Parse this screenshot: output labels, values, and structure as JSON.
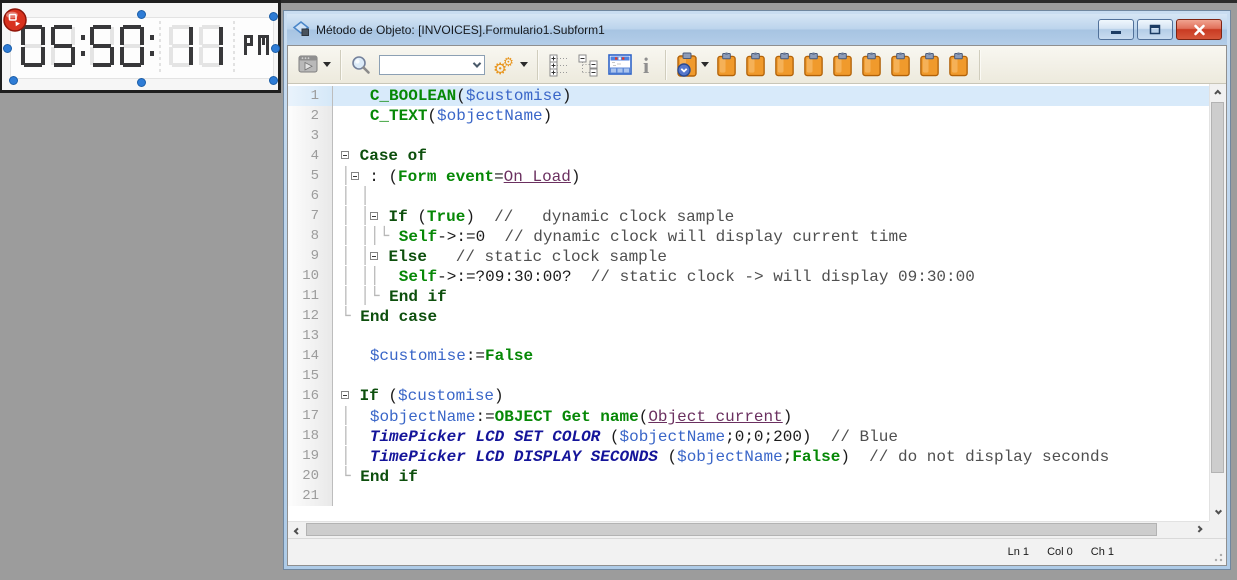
{
  "form_editor": {
    "clock_widget": {
      "time": "05:50:11",
      "meridiem": "PM",
      "ghost_pattern": "88:88:88",
      "lcd_on_color": "#38383a",
      "lcd_ghost_color": "#e4e4e4",
      "selection_color": "#2e7cd6",
      "badge_color": "#d8321e"
    }
  },
  "window": {
    "title": "Método de Objeto: [INVOICES].Formulario1.Subform1",
    "titlebar_icon": "method-icon",
    "controls": [
      "minimize",
      "maximize",
      "close"
    ]
  },
  "toolbar": {
    "icons": [
      "execute-method-icon",
      "find-icon",
      "search-combobox",
      "macros-gears-icon",
      "expand-all-icon",
      "collapse-all-icon",
      "form-preview-icon",
      "info-icon",
      "clipboard-clock-icon",
      "clipboard-icon"
    ],
    "search_value": "",
    "clipboard_count": 9,
    "clipboard_color": "#f09a2c"
  },
  "editor": {
    "active_line": 1,
    "palette": {
      "cmd": "#068806",
      "kw": "#0d4f0d",
      "var": "#3a66c8",
      "const": "#6b3060",
      "plug": "#14149a",
      "cmt": "#4f4f4f",
      "pl": "#1a1a1a"
    },
    "lines": [
      {
        "n": 1,
        "hl": true,
        "s": [
          [
            "pl",
            "   "
          ],
          [
            "cmd",
            "C_BOOLEAN"
          ],
          [
            "pl",
            "("
          ],
          [
            "var",
            "$customise"
          ],
          [
            "pl",
            ")"
          ]
        ]
      },
      {
        "n": 2,
        "s": [
          [
            "pl",
            "   "
          ],
          [
            "cmd",
            "C_TEXT"
          ],
          [
            "pl",
            "("
          ],
          [
            "var",
            "$objectName"
          ],
          [
            "pl",
            ")"
          ]
        ]
      },
      {
        "n": 3,
        "s": []
      },
      {
        "n": 4,
        "s": [
          [
            "fold",
            ""
          ],
          [
            "pl",
            " "
          ],
          [
            "kw",
            "Case of"
          ]
        ]
      },
      {
        "n": 5,
        "s": [
          [
            "tr",
            "│"
          ],
          [
            "fold",
            ""
          ],
          [
            "pl",
            " : ("
          ],
          [
            "cmd",
            "Form event"
          ],
          [
            "pl",
            "="
          ],
          [
            "const",
            "On Load"
          ],
          [
            "pl",
            ")"
          ]
        ]
      },
      {
        "n": 6,
        "s": [
          [
            "tr",
            "│ │"
          ]
        ]
      },
      {
        "n": 7,
        "s": [
          [
            "tr",
            "│ │"
          ],
          [
            "fold",
            ""
          ],
          [
            "pl",
            " "
          ],
          [
            "kw",
            "If"
          ],
          [
            "pl",
            " ("
          ],
          [
            "cmd",
            "True"
          ],
          [
            "pl",
            ")  "
          ],
          [
            "cmt",
            "//   dynamic clock sample"
          ]
        ]
      },
      {
        "n": 8,
        "s": [
          [
            "tr",
            "│ ││└"
          ],
          [
            "pl",
            " "
          ],
          [
            "cmd",
            "Self"
          ],
          [
            "pl",
            "->:=0  "
          ],
          [
            "cmt",
            "// dynamic clock will display current time"
          ]
        ]
      },
      {
        "n": 9,
        "s": [
          [
            "tr",
            "│ │"
          ],
          [
            "fold",
            ""
          ],
          [
            "pl",
            " "
          ],
          [
            "kw",
            "Else"
          ],
          [
            "pl",
            "   "
          ],
          [
            "cmt",
            "// static clock sample"
          ]
        ]
      },
      {
        "n": 10,
        "s": [
          [
            "tr",
            "│ ││"
          ],
          [
            "pl",
            "  "
          ],
          [
            "cmd",
            "Self"
          ],
          [
            "pl",
            "->:=?09:30:00?  "
          ],
          [
            "cmt",
            "// static clock -> will display 09:30:00"
          ]
        ]
      },
      {
        "n": 11,
        "s": [
          [
            "tr",
            "│ │└"
          ],
          [
            "pl",
            " "
          ],
          [
            "kw",
            "End if"
          ]
        ]
      },
      {
        "n": 12,
        "s": [
          [
            "tr",
            "└"
          ],
          [
            "pl",
            " "
          ],
          [
            "kw",
            "End case"
          ]
        ]
      },
      {
        "n": 13,
        "s": []
      },
      {
        "n": 14,
        "s": [
          [
            "pl",
            "   "
          ],
          [
            "var",
            "$customise"
          ],
          [
            "pl",
            ":="
          ],
          [
            "cmd",
            "False"
          ]
        ]
      },
      {
        "n": 15,
        "s": []
      },
      {
        "n": 16,
        "s": [
          [
            "fold",
            ""
          ],
          [
            "pl",
            " "
          ],
          [
            "kw",
            "If"
          ],
          [
            "pl",
            " ("
          ],
          [
            "var",
            "$customise"
          ],
          [
            "pl",
            ")"
          ]
        ]
      },
      {
        "n": 17,
        "s": [
          [
            "tr",
            "│"
          ],
          [
            "pl",
            "  "
          ],
          [
            "var",
            "$objectName"
          ],
          [
            "pl",
            ":="
          ],
          [
            "cmd",
            "OBJECT Get name"
          ],
          [
            "pl",
            "("
          ],
          [
            "const",
            "Object current"
          ],
          [
            "pl",
            ")"
          ]
        ]
      },
      {
        "n": 18,
        "s": [
          [
            "tr",
            "│"
          ],
          [
            "pl",
            "  "
          ],
          [
            "plug",
            "TimePicker LCD SET COLOR"
          ],
          [
            "pl",
            " ("
          ],
          [
            "var",
            "$objectName"
          ],
          [
            "pl",
            ";0;0;200)  "
          ],
          [
            "cmt",
            "// Blue"
          ]
        ]
      },
      {
        "n": 19,
        "s": [
          [
            "tr",
            "│"
          ],
          [
            "pl",
            "  "
          ],
          [
            "plug",
            "TimePicker LCD DISPLAY SECONDS"
          ],
          [
            "pl",
            " ("
          ],
          [
            "var",
            "$objectName"
          ],
          [
            "pl",
            ";"
          ],
          [
            "cmd",
            "False"
          ],
          [
            "pl",
            ")  "
          ],
          [
            "cmt",
            "// do not display seconds"
          ]
        ]
      },
      {
        "n": 20,
        "s": [
          [
            "tr",
            "└"
          ],
          [
            "pl",
            " "
          ],
          [
            "kw",
            "End if"
          ]
        ]
      },
      {
        "n": 21,
        "s": []
      }
    ]
  },
  "statusbar": {
    "ln": "Ln 1",
    "col": "Col 0",
    "ch": "Ch 1"
  }
}
